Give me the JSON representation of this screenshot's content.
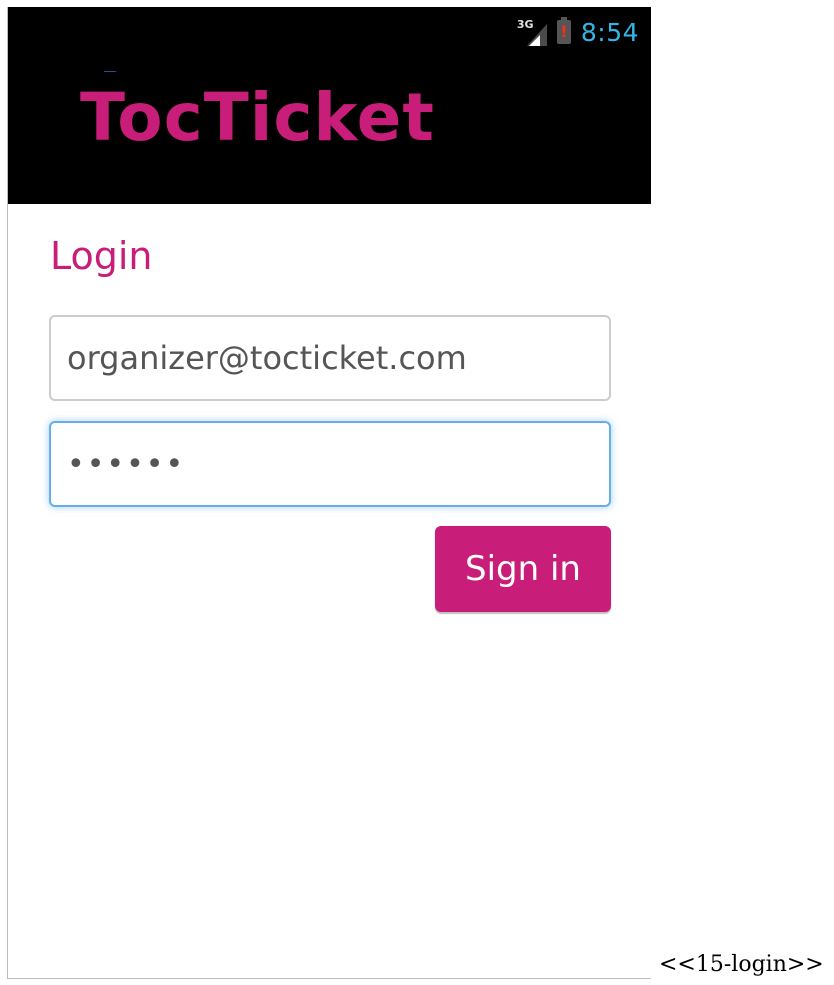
{
  "status_bar": {
    "network_type": "3G",
    "battery_alert": "!",
    "time": "8:54",
    "icons": [
      "signal-3g-icon",
      "battery-alert-icon"
    ]
  },
  "header": {
    "brand": "TocTicket"
  },
  "login": {
    "title": "Login",
    "email_value": "organizer@tocticket.com",
    "password_value": "••••••",
    "signin_label": "Sign in"
  },
  "caption": "<<15-login>>",
  "colors": {
    "brand": "#c81e79",
    "header_bg": "#000000",
    "clock": "#33b5e5",
    "focus_border": "#66afe9"
  }
}
